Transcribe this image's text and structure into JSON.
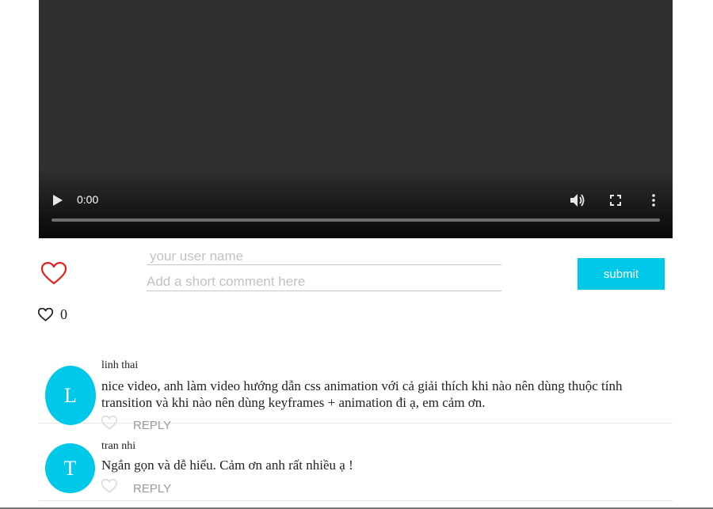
{
  "player": {
    "time": "0:00",
    "icons": [
      "play-icon",
      "volume-icon",
      "fullscreen-icon",
      "more-options-icon"
    ]
  },
  "likes": {
    "count": "0",
    "icons": [
      "heart-outline-icon"
    ],
    "heart_color": "#e02020"
  },
  "form": {
    "name_placeholder": "your user name",
    "comment_placeholder": "Add a short comment here",
    "submit_label": "submit",
    "accent": "#00c8e8"
  },
  "comments": [
    {
      "initial": "L",
      "author": "linh thai",
      "text": "nice video, anh làm video hướng dẫn css animation với cả giải thích khi nào nên dùng thuộc tính transition và khi nào nên dùng keyframes + animation đi ạ, em cảm ơn.",
      "reply_label": "REPLY"
    },
    {
      "initial": "T",
      "author": "tran nhi",
      "text": "Ngắn gọn và dễ hiểu. Cảm ơn anh rất nhiều ạ !",
      "reply_label": "REPLY"
    }
  ]
}
